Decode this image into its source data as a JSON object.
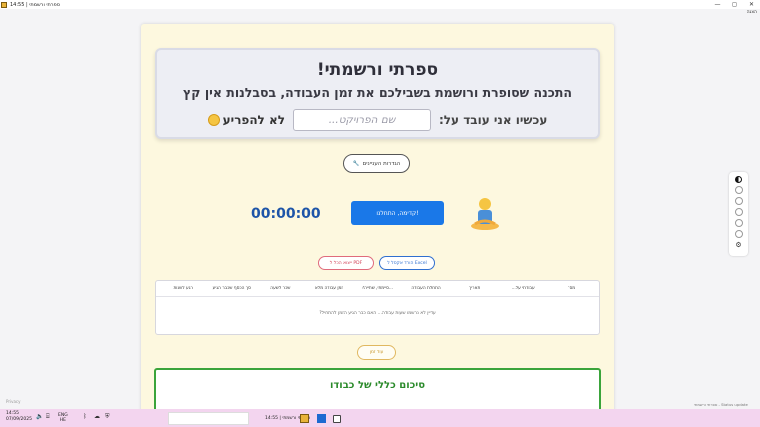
{
  "window": {
    "title": "14:55 | ספרתי ורשמתי",
    "menu": "הצגה",
    "controls": [
      "—",
      "◻",
      "✕"
    ]
  },
  "hero": {
    "title": "ספרתי ורשמתי!",
    "subtitle": "התכנה שסופרת ורושמת בשבילכם את זמן העבודה, בסבלנות אין קץ",
    "working_label": "עכשיו אני עובד על:",
    "project_placeholder": "שם הפרויקט...",
    "do_not_disturb": "לא להפריע"
  },
  "settings_button": "הגדרות העניינים",
  "timer": {
    "display": "00:00:00",
    "start_label": "קדימה, התחלנו!"
  },
  "export": {
    "excel_label": "הורד אקסל ל Excel",
    "pdf_label": "ייצוא הכל ל PDF"
  },
  "table": {
    "headers": [
      "מס'",
      "עבודתי על...",
      "תאריך",
      "התחלת העבודה",
      "...סיימתי, שתייה?",
      "זמן עבודה מלא",
      "שכר לשעה",
      "סך הכסף שכבר הגיע",
      "רגע לשנות"
    ],
    "empty_message": "עדיין לא נרשמו שעות עבודה... האם כבר הגיע הזמן להתחיל?"
  },
  "more_button": "עוד זמן",
  "summary": {
    "title": "סיכום כללי של כבודו"
  },
  "footer": {
    "left": "Privacy",
    "right": "ספרתי ורשמתי - Status update"
  },
  "taskbar": {
    "time": "14:55",
    "date": "07/09/2025",
    "lang_top": "ENG",
    "lang_bottom": "HE",
    "window_label": "ספרתי ורשמתי | 14:55"
  },
  "colors": {
    "card_bg": "#fdf8df",
    "start_button": "#1a78e8",
    "timer": "#1e55a8",
    "summary_border": "#3ba43b",
    "taskbar": "#f3d5ef"
  }
}
